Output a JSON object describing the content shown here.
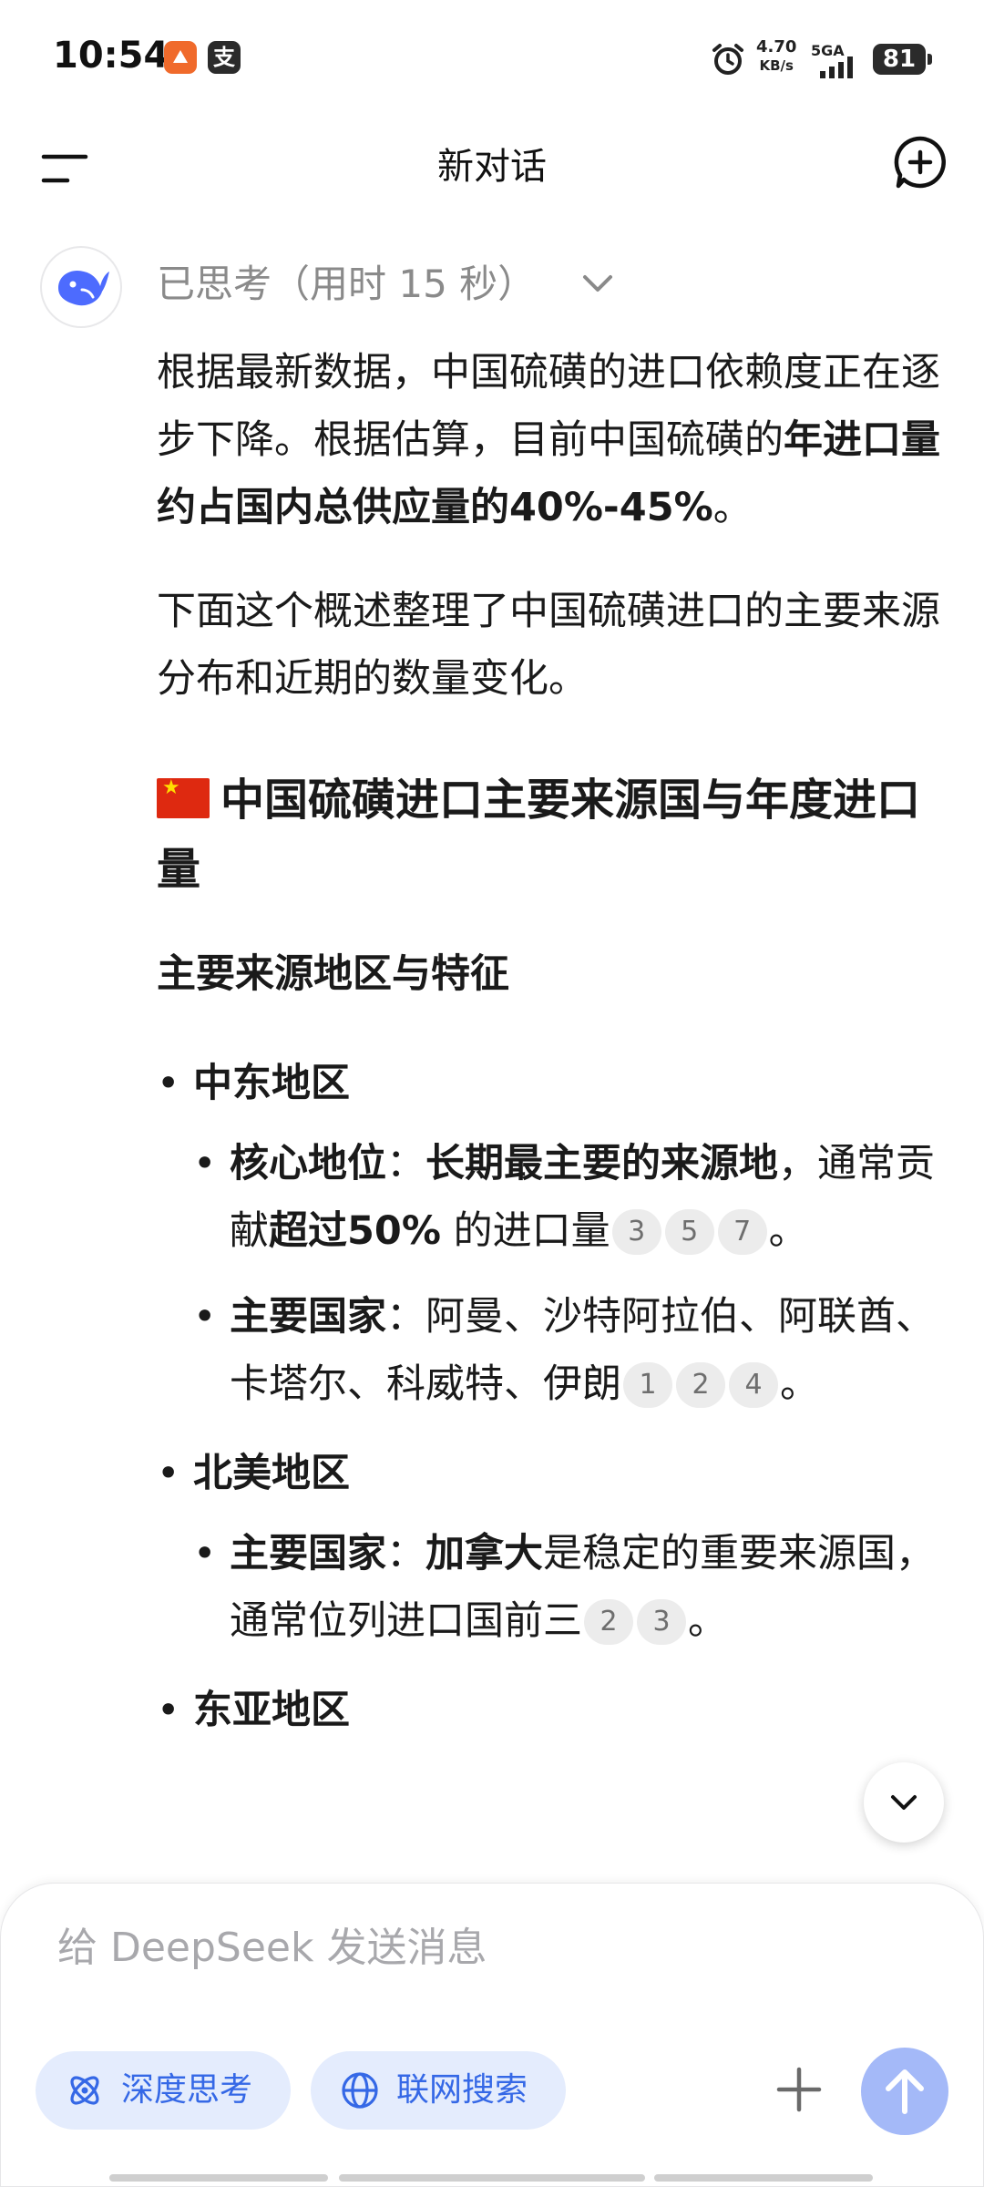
{
  "status_bar": {
    "time": "10:54",
    "app_icon_2_char": "支",
    "net_speed_value": "4.70",
    "net_speed_unit": "KB/s",
    "signal_label": "5GA",
    "battery": "81"
  },
  "header": {
    "title": "新对话"
  },
  "thinking": {
    "label": "已思考（用时 15 秒）"
  },
  "message": {
    "p1_a": "根据最新数据，中国硫磺的进口依赖度正在逐步下降。根据估算，目前中国硫磺的",
    "p1_b": "年进口量约占国内总供应量的40%-45%",
    "p1_c": "。",
    "p2": "下面这个概述整理了中国硫磺进口的主要来源分布和近期的数量变化。",
    "section_heading": "中国硫磺进口主要来源国与年度进口量",
    "subheading": "主要来源地区与特征",
    "regions": [
      {
        "name": "中东地区",
        "items": [
          {
            "label": "核心地位",
            "sep": "：",
            "bold": "长期最主要的来源地",
            "text_a": "，通常贡献",
            "bold2": "超过50%",
            "text_b": " 的进口量",
            "cites": [
              "3",
              "5",
              "7"
            ],
            "end": "。"
          },
          {
            "label": "主要国家",
            "sep": "：",
            "text_a": "阿曼、沙特阿拉伯、阿联酋、卡塔尔、科威特、伊朗",
            "cites": [
              "1",
              "2",
              "4"
            ],
            "end": "。"
          }
        ]
      },
      {
        "name": "北美地区",
        "items": [
          {
            "label": "主要国家",
            "sep": "：",
            "bold": "加拿大",
            "text_a": "是稳定的重要来源国，通常位列进口国前三",
            "cites": [
              "2",
              "3"
            ],
            "end": "。"
          }
        ]
      },
      {
        "name": "东亚地区"
      }
    ]
  },
  "composer": {
    "placeholder": "给 DeepSeek 发送消息",
    "deep_think_label": "深度思考",
    "web_search_label": "联网搜索"
  },
  "colors": {
    "accent": "#3568e6",
    "chip_bg": "#e4ecfd",
    "send_button": "#a4b9f8",
    "citation_bg": "#ececec",
    "muted_text": "#8a8a8a"
  },
  "icons": {
    "menu": "menu-icon",
    "new_chat": "new-chat-icon",
    "avatar": "deepseek-whale-icon",
    "chevron": "chevron-down-icon",
    "deep_think": "atom-icon",
    "web_search": "globe-icon",
    "add": "plus-icon",
    "send": "arrow-up-icon",
    "alarm": "alarm-clock-icon"
  }
}
